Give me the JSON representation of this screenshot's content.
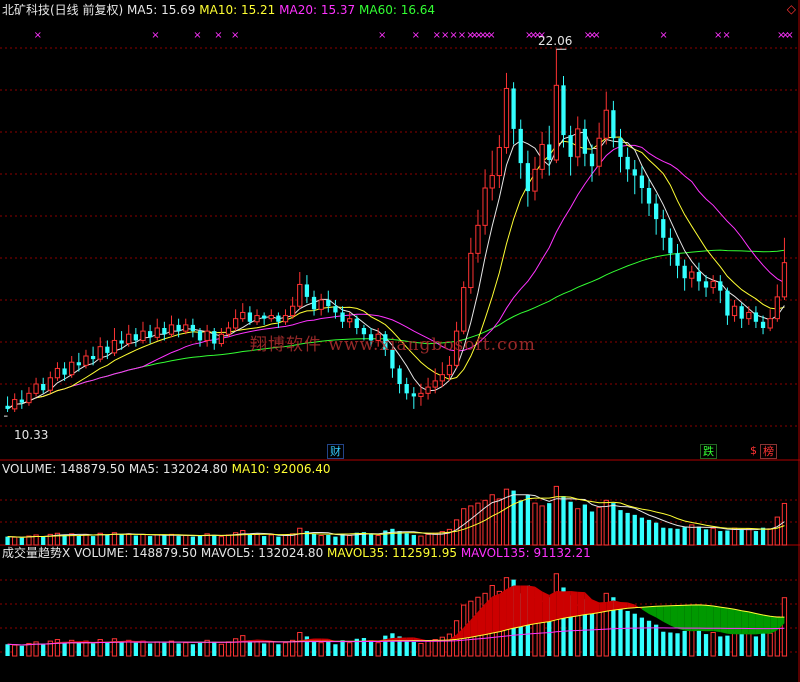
{
  "header": {
    "title": "北矿科技(日线 前复权)",
    "ma5": "MA5: 15.69",
    "ma10": "MA10: 15.21",
    "ma20": "MA20: 15.37",
    "ma60": "MA60: 16.64"
  },
  "price_annotations": {
    "high": "22.06",
    "low": "10.33"
  },
  "watermark": "翔博软件 www.xiangbosoft.com",
  "event_badges": {
    "cai": "财",
    "die": "跌",
    "dollar": "$",
    "bang": "榜"
  },
  "volume_panel": {
    "label": "VOLUME: 148879.50",
    "ma5": "MA5: 132024.80",
    "ma10": "MA10: 92006.40"
  },
  "trend_panel": {
    "title": "成交量趋势X",
    "volume": "VOLUME: 148879.50",
    "mavol5": "MAVOL5: 132024.80",
    "mavol35": "MAVOL35: 112591.95",
    "mavol135": "MAVOL135: 91132.21"
  },
  "colors": {
    "up": "#ff3333",
    "down": "#33ffff",
    "ma5": "#e6e6e6",
    "ma10": "#ffff33",
    "ma20": "#ff33ff",
    "ma60": "#33ff33",
    "grid": "#8b0000",
    "area_up": "#cc0000",
    "area_down": "#009900"
  },
  "chart_data": [
    {
      "type": "candlestick",
      "title": "北矿科技(日线 前复权)",
      "ylim": [
        9.5,
        23.0
      ],
      "price_high": 22.06,
      "price_low": 10.33,
      "candles": [
        [
          10.6,
          10.5,
          10.9,
          10.4
        ],
        [
          10.5,
          10.8,
          11.0,
          10.4
        ],
        [
          10.8,
          10.7,
          11.1,
          10.5
        ],
        [
          10.7,
          11.0,
          11.2,
          10.6
        ],
        [
          11.0,
          11.3,
          11.5,
          10.9
        ],
        [
          11.3,
          11.1,
          11.5,
          11.0
        ],
        [
          11.1,
          11.5,
          11.7,
          11.0
        ],
        [
          11.5,
          11.8,
          12.0,
          11.4
        ],
        [
          11.8,
          11.6,
          12.0,
          11.4
        ],
        [
          11.6,
          12.0,
          12.2,
          11.5
        ],
        [
          12.0,
          11.9,
          12.3,
          11.7
        ],
        [
          11.9,
          12.2,
          12.4,
          11.8
        ],
        [
          12.2,
          12.1,
          12.5,
          11.9
        ],
        [
          12.1,
          12.5,
          12.8,
          12.0
        ],
        [
          12.5,
          12.3,
          12.7,
          12.1
        ],
        [
          12.3,
          12.7,
          13.1,
          12.2
        ],
        [
          12.7,
          12.6,
          13.0,
          12.4
        ],
        [
          12.6,
          12.9,
          13.2,
          12.5
        ],
        [
          12.9,
          12.7,
          13.1,
          12.5
        ],
        [
          12.7,
          13.0,
          13.3,
          12.6
        ],
        [
          13.0,
          12.8,
          13.2,
          12.6
        ],
        [
          12.8,
          13.1,
          13.4,
          12.7
        ],
        [
          13.1,
          12.9,
          13.3,
          12.7
        ],
        [
          12.9,
          13.2,
          13.5,
          12.8
        ],
        [
          13.2,
          13.0,
          13.4,
          12.8
        ],
        [
          13.0,
          13.2,
          13.4,
          12.9
        ],
        [
          13.2,
          13.0,
          13.4,
          12.8
        ],
        [
          13.0,
          12.7,
          13.1,
          12.5
        ],
        [
          12.7,
          13.0,
          13.2,
          12.5
        ],
        [
          13.0,
          12.6,
          13.1,
          12.4
        ],
        [
          12.6,
          12.9,
          13.1,
          12.5
        ],
        [
          12.9,
          13.1,
          13.3,
          12.8
        ],
        [
          13.1,
          13.4,
          13.7,
          13.0
        ],
        [
          13.4,
          13.6,
          13.9,
          13.3
        ],
        [
          13.6,
          13.3,
          13.8,
          13.2
        ],
        [
          13.3,
          13.5,
          13.7,
          13.2
        ],
        [
          13.5,
          13.4,
          13.6,
          13.2
        ],
        [
          13.4,
          13.5,
          13.7,
          13.3
        ],
        [
          13.5,
          13.3,
          13.6,
          13.1
        ],
        [
          13.3,
          13.5,
          13.7,
          13.2
        ],
        [
          13.5,
          13.8,
          14.1,
          13.4
        ],
        [
          13.8,
          14.5,
          14.9,
          13.7
        ],
        [
          14.5,
          14.1,
          14.8,
          13.9
        ],
        [
          14.1,
          13.7,
          14.3,
          13.5
        ],
        [
          13.7,
          14.0,
          14.2,
          13.5
        ],
        [
          14.0,
          13.8,
          14.3,
          13.6
        ],
        [
          13.8,
          13.6,
          14.0,
          13.4
        ],
        [
          13.6,
          13.3,
          13.8,
          13.1
        ],
        [
          13.3,
          13.4,
          13.6,
          13.1
        ],
        [
          13.4,
          13.1,
          13.5,
          12.9
        ],
        [
          13.1,
          12.9,
          13.2,
          12.7
        ],
        [
          12.9,
          12.7,
          13.1,
          12.5
        ],
        [
          12.7,
          12.9,
          13.1,
          12.5
        ],
        [
          12.9,
          12.4,
          13.0,
          12.2
        ],
        [
          12.4,
          11.8,
          12.5,
          11.5
        ],
        [
          11.8,
          11.3,
          11.9,
          11.0
        ],
        [
          11.3,
          11.0,
          11.5,
          10.8
        ],
        [
          11.0,
          10.9,
          11.2,
          10.5
        ],
        [
          10.9,
          11.0,
          11.3,
          10.6
        ],
        [
          11.0,
          11.2,
          11.5,
          10.8
        ],
        [
          11.2,
          11.4,
          11.8,
          11.0
        ],
        [
          11.4,
          11.6,
          12.0,
          11.2
        ],
        [
          11.6,
          11.9,
          12.2,
          11.4
        ],
        [
          11.9,
          13.0,
          13.3,
          11.8
        ],
        [
          13.0,
          14.4,
          14.6,
          12.9
        ],
        [
          14.4,
          15.5,
          16.0,
          14.2
        ],
        [
          15.5,
          16.4,
          16.9,
          15.2
        ],
        [
          16.4,
          17.6,
          18.2,
          16.1
        ],
        [
          17.6,
          18.0,
          18.8,
          17.2
        ],
        [
          18.0,
          18.9,
          19.3,
          17.6
        ],
        [
          18.9,
          20.8,
          21.3,
          18.7
        ],
        [
          20.8,
          19.5,
          21.0,
          19.0
        ],
        [
          19.5,
          18.4,
          19.8,
          17.9
        ],
        [
          18.4,
          17.5,
          18.8,
          17.0
        ],
        [
          17.5,
          18.2,
          18.6,
          17.2
        ],
        [
          18.2,
          19.0,
          19.4,
          17.9
        ],
        [
          19.0,
          18.5,
          19.6,
          18.0
        ],
        [
          18.5,
          20.9,
          22.06,
          18.4
        ],
        [
          20.9,
          19.3,
          21.2,
          18.9
        ],
        [
          19.3,
          18.6,
          19.6,
          18.0
        ],
        [
          18.6,
          19.5,
          19.9,
          18.3
        ],
        [
          19.5,
          18.7,
          19.8,
          18.3
        ],
        [
          18.7,
          18.3,
          19.0,
          17.8
        ],
        [
          18.3,
          19.2,
          19.7,
          18.0
        ],
        [
          19.2,
          20.1,
          20.7,
          19.0
        ],
        [
          20.1,
          19.2,
          20.4,
          18.9
        ],
        [
          19.2,
          18.6,
          19.5,
          18.1
        ],
        [
          18.6,
          18.2,
          18.9,
          17.8
        ],
        [
          18.2,
          18.0,
          18.5,
          17.4
        ],
        [
          18.0,
          17.6,
          18.3,
          17.1
        ],
        [
          17.6,
          17.1,
          17.9,
          16.7
        ],
        [
          17.1,
          16.6,
          17.4,
          16.1
        ],
        [
          16.6,
          16.0,
          16.9,
          15.6
        ],
        [
          16.0,
          15.5,
          16.3,
          15.1
        ],
        [
          15.5,
          15.1,
          15.8,
          14.7
        ],
        [
          15.1,
          14.7,
          15.3,
          14.3
        ],
        [
          14.7,
          14.9,
          15.1,
          14.4
        ],
        [
          14.9,
          14.6,
          15.2,
          14.3
        ],
        [
          14.6,
          14.4,
          14.8,
          14.1
        ],
        [
          14.4,
          14.6,
          14.8,
          14.2
        ],
        [
          14.6,
          14.3,
          14.8,
          13.9
        ],
        [
          14.3,
          13.5,
          14.4,
          13.2
        ],
        [
          13.5,
          13.8,
          14.0,
          13.3
        ],
        [
          13.8,
          13.4,
          13.9,
          13.1
        ],
        [
          13.4,
          13.6,
          13.8,
          13.2
        ],
        [
          13.6,
          13.3,
          13.8,
          13.1
        ],
        [
          13.3,
          13.1,
          13.5,
          12.9
        ],
        [
          13.1,
          13.4,
          13.7,
          13.0
        ],
        [
          13.4,
          14.1,
          14.5,
          13.3
        ],
        [
          14.1,
          15.2,
          16.0,
          14.0
        ]
      ]
    },
    {
      "type": "bar",
      "title": "VOLUME",
      "ylim": [
        0,
        240000
      ],
      "values": [
        30000,
        28000,
        26000,
        32000,
        36000,
        30000,
        38000,
        42000,
        36000,
        40000,
        34000,
        38000,
        32000,
        42000,
        36000,
        44000,
        38000,
        40000,
        34000,
        38000,
        32000,
        36000,
        34000,
        38000,
        32000,
        34000,
        30000,
        34000,
        40000,
        36000,
        30000,
        36000,
        44000,
        52000,
        40000,
        38000,
        32000,
        36000,
        30000,
        34000,
        40000,
        60000,
        50000,
        40000,
        34000,
        36000,
        30000,
        40000,
        34000,
        44000,
        46000,
        40000,
        34000,
        52000,
        58000,
        50000,
        42000,
        36000,
        32000,
        38000,
        42000,
        48000,
        56000,
        90000,
        130000,
        140000,
        150000,
        160000,
        180000,
        165000,
        200000,
        195000,
        160000,
        180000,
        150000,
        140000,
        150000,
        210000,
        175000,
        155000,
        130000,
        145000,
        120000,
        135000,
        160000,
        150000,
        125000,
        115000,
        108000,
        98000,
        90000,
        80000,
        62000,
        60000,
        58000,
        64000,
        72000,
        66000,
        56000,
        60000,
        50000,
        52000,
        60000,
        56000,
        58000,
        50000,
        62000,
        58000,
        100000,
        148879.5
      ]
    }
  ]
}
